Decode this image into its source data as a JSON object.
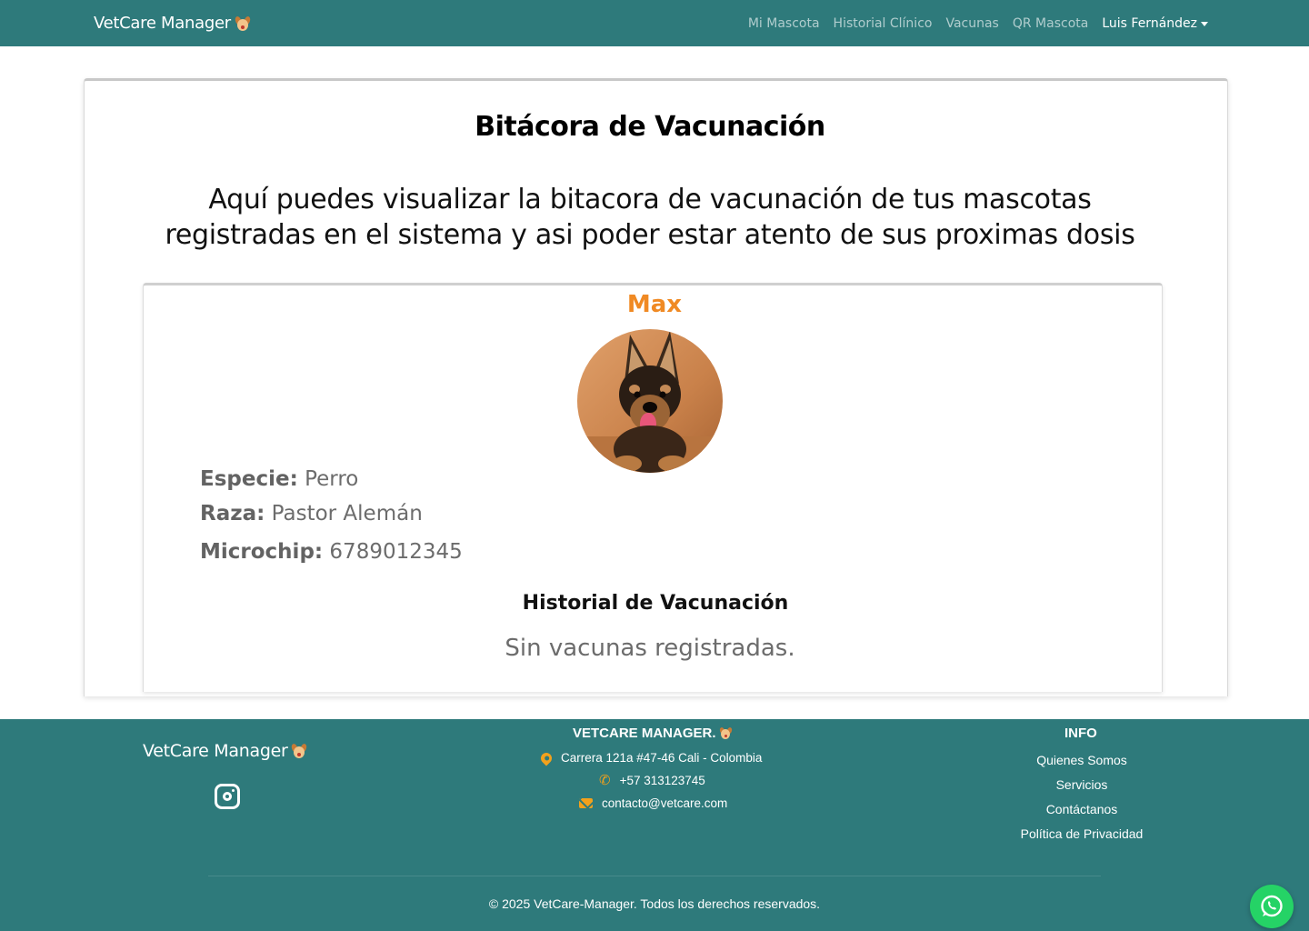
{
  "navbar": {
    "brand": "VetCare Manager",
    "links": [
      "Mi Mascota",
      "Historial Clínico",
      "Vacunas",
      "QR Mascota"
    ],
    "user_name": "Luis Fernández"
  },
  "page": {
    "title": "Bitácora de Vacunación",
    "description": "Aquí puedes visualizar la bitacora de vacunación de tus mascotas registradas en el sistema y asi poder estar atento de sus proximas dosis"
  },
  "pet": {
    "name": "Max",
    "especie_label": "Especie:",
    "especie_value": "Perro",
    "raza_label": "Raza:",
    "raza_value": "Pastor Alemán",
    "microchip_label": "Microchip:",
    "microchip_value": "6789012345",
    "history_title": "Historial de Vacunación",
    "history_empty": "Sin vacunas registradas."
  },
  "footer": {
    "brand": "VetCare Manager",
    "company_title": "VETCARE MANAGER.",
    "address": "Carrera 121a #47-46 Cali - Colombia",
    "phone": "+57 313123745",
    "email": "contacto@vetcare.com",
    "info_title": "INFO",
    "info_links": [
      "Quienes Somos",
      "Servicios",
      "Contáctanos",
      "Política de Privacidad"
    ],
    "copyright": "© 2025 VetCare-Manager. Todos los derechos reservados."
  },
  "colors": {
    "primary": "#2e7a7b",
    "accent_orange": "#f08a24",
    "icon_orange": "#f2a11c",
    "whatsapp": "#25d366"
  },
  "icons": [
    "puppy-emoji-icon",
    "caret-down-icon",
    "instagram-icon",
    "map-pin-icon",
    "phone-icon",
    "envelope-icon",
    "whatsapp-icon"
  ]
}
